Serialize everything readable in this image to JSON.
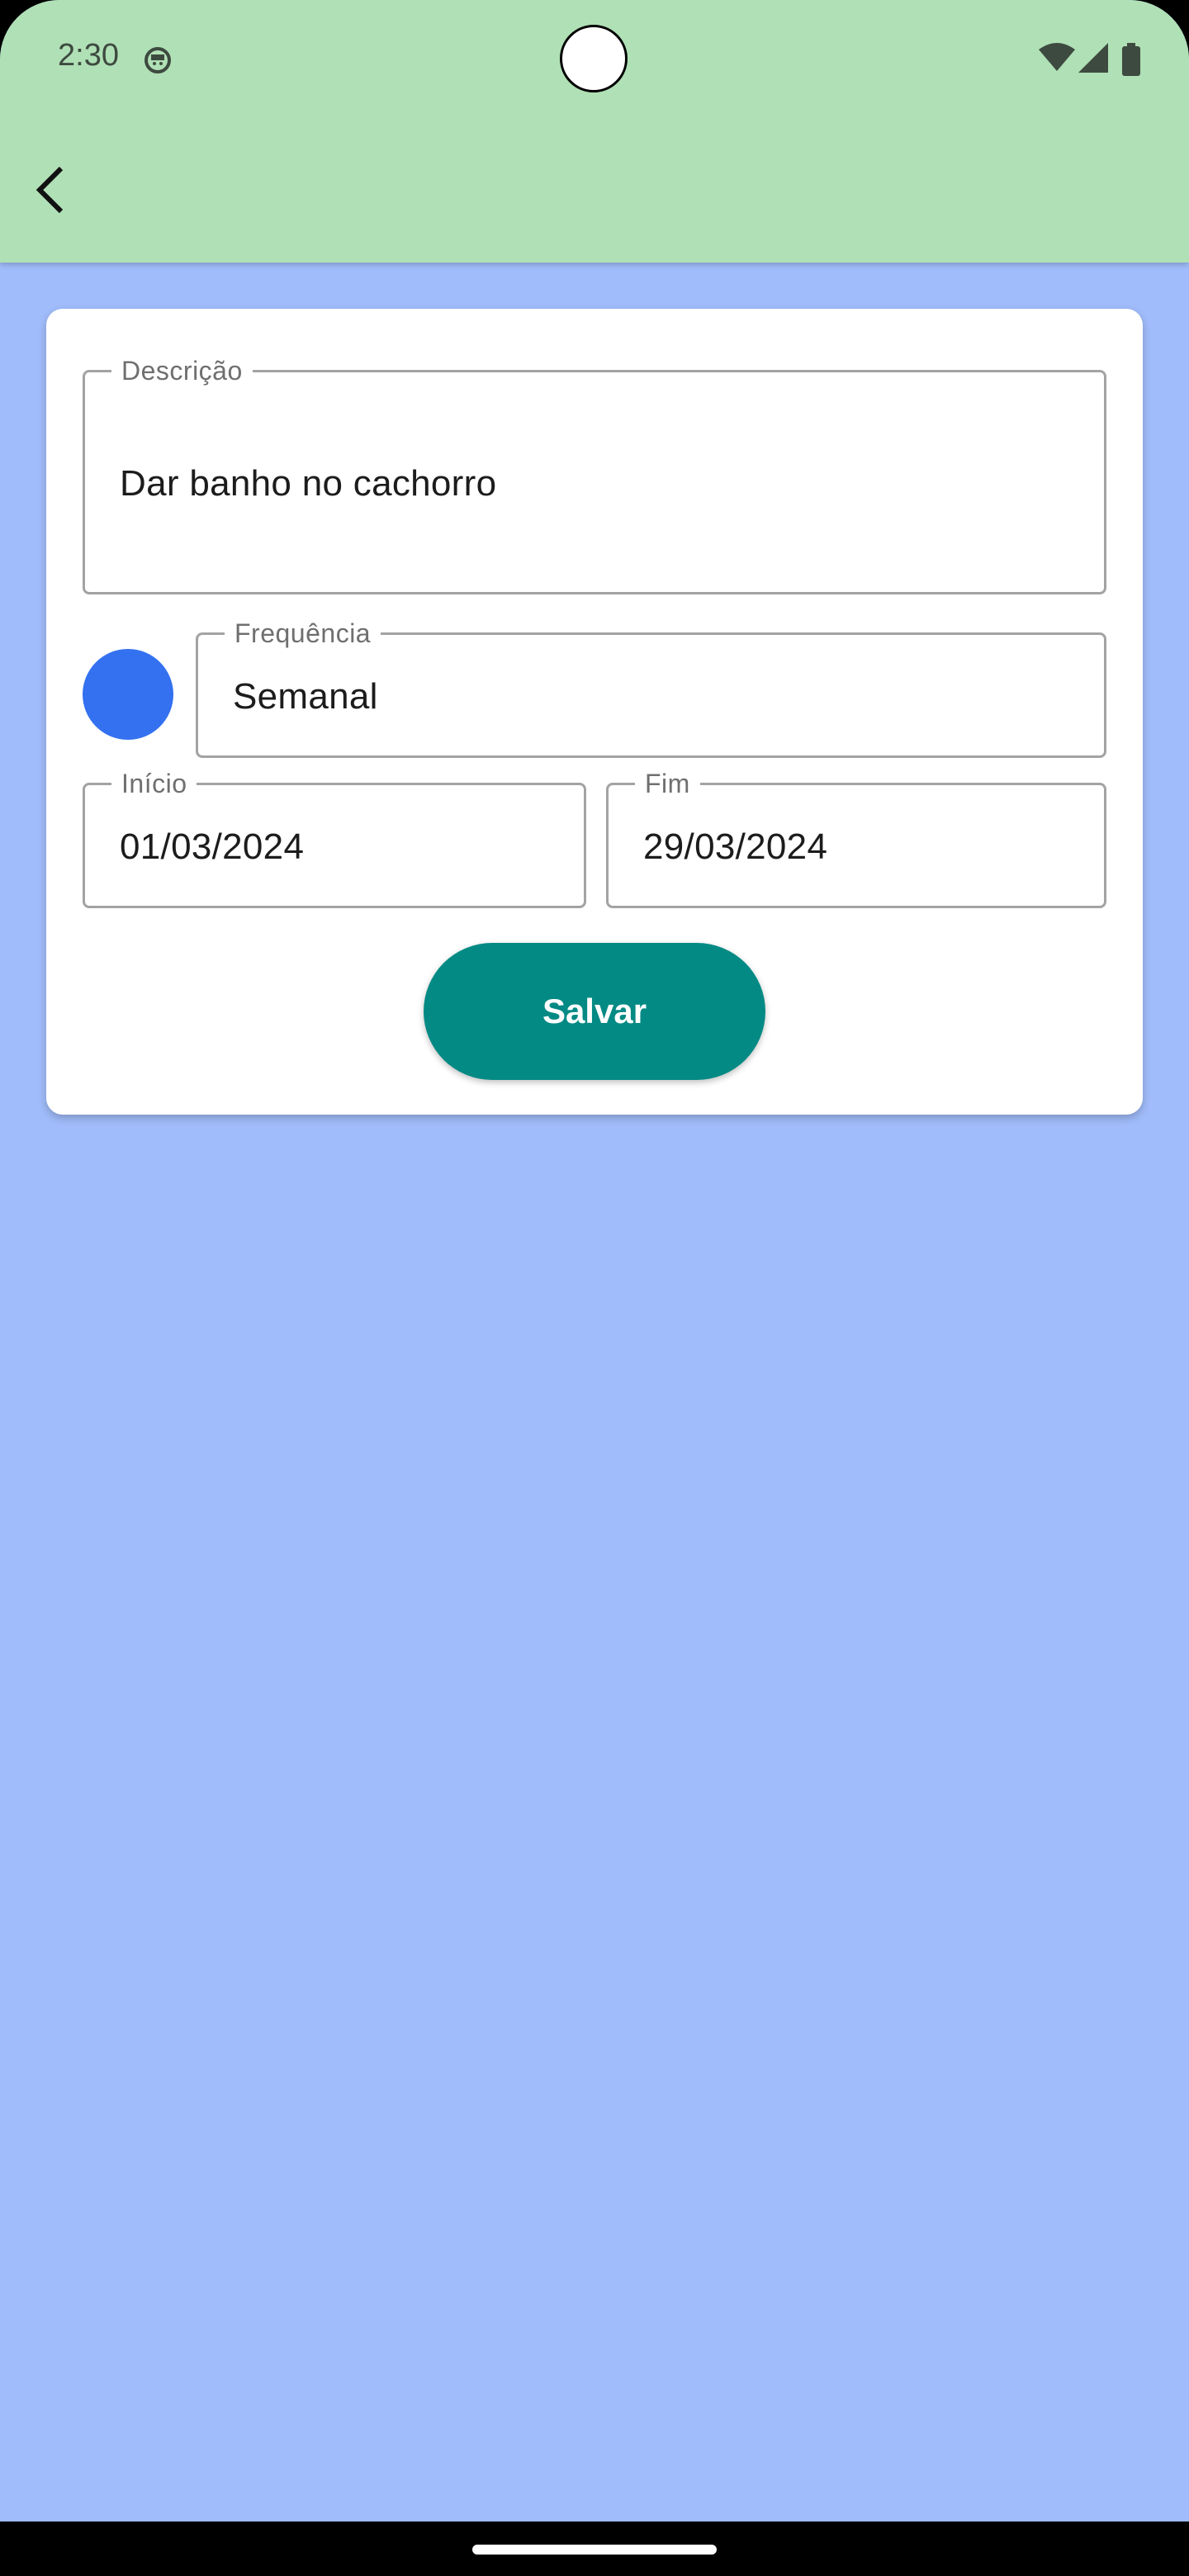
{
  "status_bar": {
    "time": "2:30"
  },
  "form": {
    "description": {
      "label": "Descrição",
      "value": "Dar banho no cachorro"
    },
    "frequency": {
      "label": "Frequência",
      "value": "Semanal"
    },
    "start": {
      "label": "Início",
      "value": "01/03/2024"
    },
    "end": {
      "label": "Fim",
      "value": "29/03/2024"
    },
    "color": "#3471f0",
    "save_label": "Salvar"
  },
  "colors": {
    "header_bg": "#b0e0b6",
    "page_bg": "#a0bcfa",
    "save_button_bg": "#048a84"
  }
}
